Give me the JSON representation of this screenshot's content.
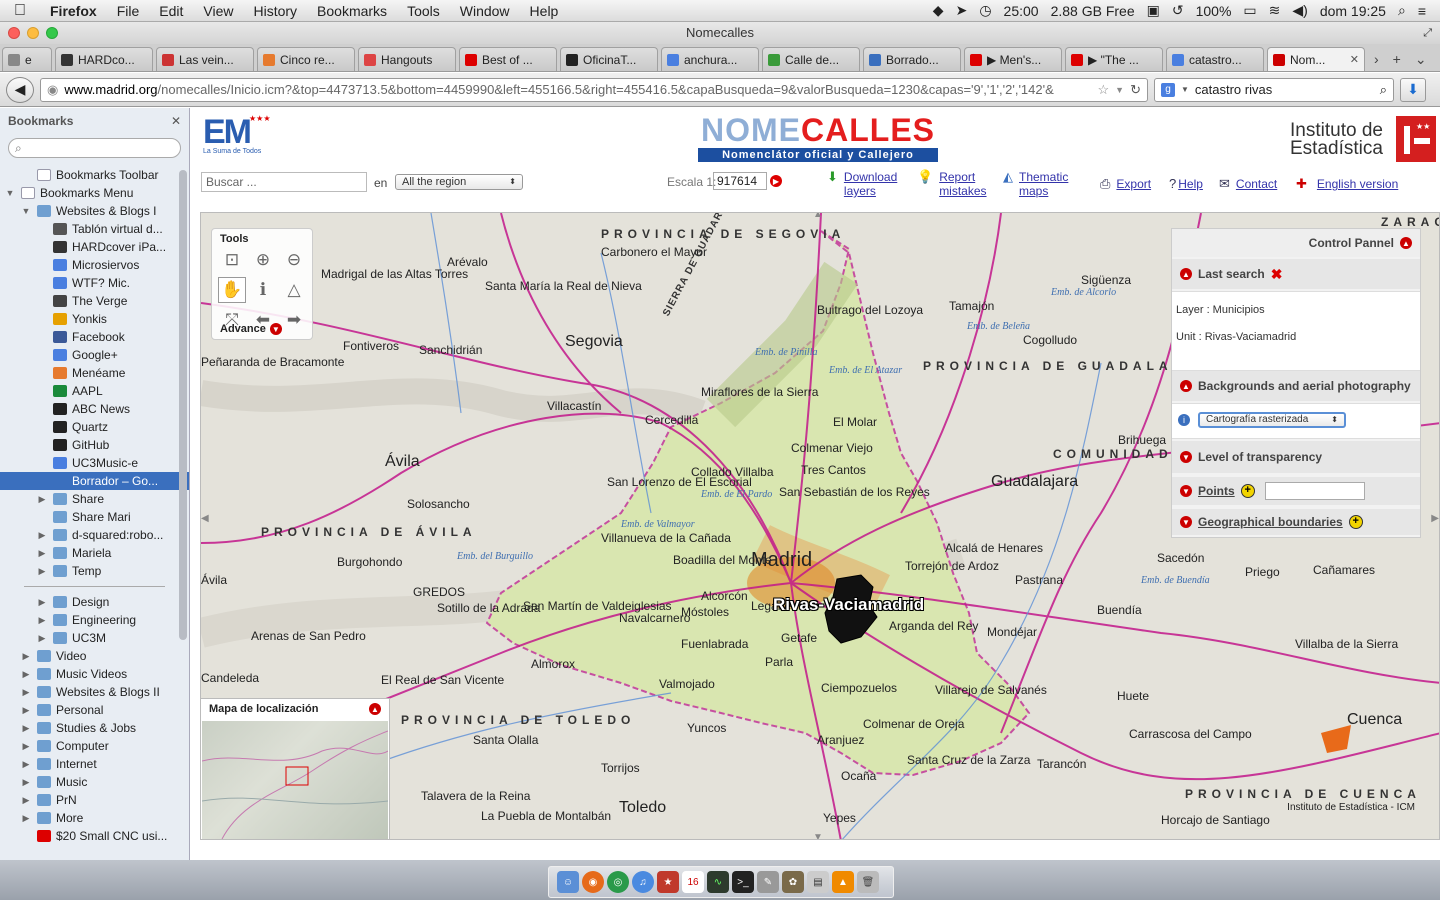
{
  "menubar": {
    "app": "Firefox",
    "items": [
      "File",
      "Edit",
      "View",
      "History",
      "Bookmarks",
      "Tools",
      "Window",
      "Help"
    ],
    "status": {
      "timer": "25:00",
      "memory": "2.88 GB Free",
      "battery": "100%",
      "clock": "dom 19:25"
    }
  },
  "window": {
    "title": "Nomecalles"
  },
  "tabs": [
    {
      "label": "e",
      "icon_color": "#888"
    },
    {
      "label": "HARDco...",
      "icon_color": "#333"
    },
    {
      "label": "Las vein...",
      "icon_color": "#c33"
    },
    {
      "label": "Cinco re...",
      "icon_color": "#e67a2e"
    },
    {
      "label": "Hangouts",
      "icon_color": "#d44"
    },
    {
      "label": "Best of ...",
      "icon_color": "#d00"
    },
    {
      "label": "OficinaT...",
      "icon_color": "#222"
    },
    {
      "label": "anchura...",
      "icon_color": "#4a7fe0"
    },
    {
      "label": "Calle de...",
      "icon_color": "#3a9b3a"
    },
    {
      "label": "Borrado...",
      "icon_color": "#3a6fbe"
    },
    {
      "label": "▶ Men's...",
      "icon_color": "#d00"
    },
    {
      "label": "▶ \"The ...",
      "icon_color": "#d00"
    },
    {
      "label": "catastro...",
      "icon_color": "#4a7fe0"
    },
    {
      "label": "Nom...",
      "icon_color": "#c00"
    }
  ],
  "navbar": {
    "url_host": "www.madrid.org",
    "url_rest": "/nomecalles/Inicio.icm?&top=4473713.5&bottom=4459990&left=455166.5&right=455416.5&capaBusqueda=9&valorBusqueda=1230&capas='9','1','2','142'&",
    "search_value": "catastro rivas"
  },
  "sidebar": {
    "title": "Bookmarks",
    "items": [
      {
        "label": "Bookmarks Toolbar",
        "depth": 1,
        "type": "special",
        "twisty": ""
      },
      {
        "label": "Bookmarks Menu",
        "depth": 0,
        "type": "special",
        "twisty": "▼"
      },
      {
        "label": "Websites & Blogs I",
        "depth": 1,
        "type": "folder",
        "twisty": "▼"
      },
      {
        "label": "Tablón virtual d...",
        "depth": 2,
        "type": "bm",
        "color": "#555"
      },
      {
        "label": "HARDcover iPa...",
        "depth": 2,
        "type": "bm",
        "color": "#333"
      },
      {
        "label": "Microsiervos",
        "depth": 2,
        "type": "bm",
        "color": "#4a7fe0"
      },
      {
        "label": "WTF? Mic.",
        "depth": 2,
        "type": "bm",
        "color": "#4a7fe0"
      },
      {
        "label": "The Verge",
        "depth": 2,
        "type": "bm",
        "color": "#444"
      },
      {
        "label": "Yonkis",
        "depth": 2,
        "type": "bm",
        "color": "#e6a000"
      },
      {
        "label": "Facebook",
        "depth": 2,
        "type": "bm",
        "color": "#3b5998"
      },
      {
        "label": "Google+",
        "depth": 2,
        "type": "bm",
        "color": "#4a7fe0"
      },
      {
        "label": "Menéame",
        "depth": 2,
        "type": "bm",
        "color": "#e67a2e"
      },
      {
        "label": "AAPL",
        "depth": 2,
        "type": "bm",
        "color": "#1a8a3a"
      },
      {
        "label": "ABC News",
        "depth": 2,
        "type": "bm",
        "color": "#222"
      },
      {
        "label": "Quartz",
        "depth": 2,
        "type": "bm",
        "color": "#222"
      },
      {
        "label": "GitHub",
        "depth": 2,
        "type": "bm",
        "color": "#222"
      },
      {
        "label": "UC3Music-e",
        "depth": 2,
        "type": "bm",
        "color": "#4a7fe0"
      },
      {
        "label": "Borrador – Go...",
        "depth": 2,
        "type": "bm",
        "color": "#3a6fbe",
        "selected": true
      },
      {
        "label": "Share",
        "depth": 2,
        "type": "folder",
        "twisty": "▶"
      },
      {
        "label": "Share Mari",
        "depth": 2,
        "type": "folder",
        "twisty": ""
      },
      {
        "label": "d-squared:robo...",
        "depth": 2,
        "type": "folder",
        "twisty": "▶"
      },
      {
        "label": "Mariela",
        "depth": 2,
        "type": "folder",
        "twisty": "▶"
      },
      {
        "label": "Temp",
        "depth": 2,
        "type": "folder",
        "twisty": "▶"
      },
      {
        "label": "—sep—",
        "depth": 0,
        "type": "sep"
      },
      {
        "label": "Design",
        "depth": 2,
        "type": "folder",
        "twisty": "▶"
      },
      {
        "label": "Engineering",
        "depth": 2,
        "type": "folder",
        "twisty": "▶"
      },
      {
        "label": "UC3M",
        "depth": 2,
        "type": "folder",
        "twisty": "▶"
      },
      {
        "label": "Video",
        "depth": 1,
        "type": "folder",
        "twisty": "▶"
      },
      {
        "label": "Music Videos",
        "depth": 1,
        "type": "folder",
        "twisty": "▶"
      },
      {
        "label": "Websites & Blogs II",
        "depth": 1,
        "type": "folder",
        "twisty": "▶"
      },
      {
        "label": "Personal",
        "depth": 1,
        "type": "folder",
        "twisty": "▶"
      },
      {
        "label": "Studies & Jobs",
        "depth": 1,
        "type": "folder",
        "twisty": "▶"
      },
      {
        "label": "Computer",
        "depth": 1,
        "type": "folder",
        "twisty": "▶"
      },
      {
        "label": "Internet",
        "depth": 1,
        "type": "folder",
        "twisty": "▶"
      },
      {
        "label": "Music",
        "depth": 1,
        "type": "folder",
        "twisty": "▶"
      },
      {
        "label": "PrN",
        "depth": 1,
        "type": "folder",
        "twisty": "▶"
      },
      {
        "label": "More",
        "depth": 1,
        "type": "folder",
        "twisty": "▶"
      },
      {
        "label": "$20 Small CNC usi...",
        "depth": 1,
        "type": "bm",
        "color": "#d00"
      }
    ]
  },
  "page": {
    "em_logo_text": "EM",
    "em_logo_sub": "La Suma de Todos",
    "nc_logo_a": "NOME",
    "nc_logo_b": "CALLES",
    "nc_subtitle": "Nomenclátor oficial y Callejero",
    "ine_line1": "Instituto de",
    "ine_line2": "Estadística",
    "search_placeholder": "Buscar ...",
    "en_label": "en",
    "region_value": "All the region",
    "scale_label": "Escala 1:",
    "scale_value": "917614",
    "links": {
      "download": "Download layers",
      "report": "Report mistakes",
      "thematic": "Thematic maps",
      "export": "Export",
      "help": "Help",
      "contact": "Contact",
      "english": "English version"
    }
  },
  "map": {
    "tools_title": "Tools",
    "advance": "Advance",
    "locmap_title": "Mapa de localización",
    "credit": "Instituto de Estadística - ICM",
    "selected_unit_label": "Rivas-Vaciamadrid",
    "labels": [
      {
        "t": "PROVINCIA DE SEGOVIA",
        "c": "prov"
      },
      {
        "t": "Carbonero el Mayor",
        "c": "town"
      },
      {
        "t": "Arévalo",
        "c": "town"
      },
      {
        "t": "Madrigal de las Altas Torres",
        "c": "town"
      },
      {
        "t": "Santa María la Real de Nieva",
        "c": "town"
      },
      {
        "t": "Segovia",
        "c": "city"
      },
      {
        "t": "Fontiveros",
        "c": "town"
      },
      {
        "t": "Sanchidrián",
        "c": "town"
      },
      {
        "t": "Peñaranda de Bracamonte",
        "c": "town"
      },
      {
        "t": "Villacastín",
        "c": "town"
      },
      {
        "t": "Ávila",
        "c": "city"
      },
      {
        "t": "Solosancho",
        "c": "town"
      },
      {
        "t": "PROVINCIA DE ÁVILA",
        "c": "prov"
      },
      {
        "t": "Burgohondo",
        "c": "town"
      },
      {
        "t": "GREDOS",
        "c": "town"
      },
      {
        "t": "Arenas de San Pedro",
        "c": "town"
      },
      {
        "t": "Candeleda",
        "c": "town"
      },
      {
        "t": "El Real de San Vicente",
        "c": "town"
      },
      {
        "t": "Sotillo de la Adrada",
        "c": "town"
      },
      {
        "t": "Madrid",
        "c": "big"
      },
      {
        "t": "Alcalá de Henares",
        "c": "town"
      },
      {
        "t": "Torrejón de Ardoz",
        "c": "town"
      },
      {
        "t": "Guadalajara",
        "c": "city"
      },
      {
        "t": "COMUNIDAD D",
        "c": "prov"
      },
      {
        "t": "PROVINCIA DE GUADALAJA",
        "c": "prov"
      },
      {
        "t": "Brihuega",
        "c": "town"
      },
      {
        "t": "Cogolludo",
        "c": "town"
      },
      {
        "t": "Sigüenza",
        "c": "town"
      },
      {
        "t": "Tamajón",
        "c": "town"
      },
      {
        "t": "Buitrago del Lozoya",
        "c": "town"
      },
      {
        "t": "Miraflores de la Sierra",
        "c": "town"
      },
      {
        "t": "El Molar",
        "c": "town"
      },
      {
        "t": "Colmenar Viejo",
        "c": "town"
      },
      {
        "t": "Tres Cantos",
        "c": "town"
      },
      {
        "t": "Collado Villalba",
        "c": "town"
      },
      {
        "t": "San Lorenzo de El Escorial",
        "c": "town"
      },
      {
        "t": "San Sebastián de los Reyes",
        "c": "town"
      },
      {
        "t": "Cercedilla",
        "c": "town"
      },
      {
        "t": "Villanueva de la Cañada",
        "c": "town"
      },
      {
        "t": "Boadilla del Monte",
        "c": "town"
      },
      {
        "t": "Alcorcón",
        "c": "town"
      },
      {
        "t": "Leganés",
        "c": "town"
      },
      {
        "t": "Móstoles",
        "c": "town"
      },
      {
        "t": "Getafe",
        "c": "town"
      },
      {
        "t": "Fuenlabrada",
        "c": "town"
      },
      {
        "t": "Navalcarnero",
        "c": "town"
      },
      {
        "t": "San Martín de Valdeiglesias",
        "c": "town"
      },
      {
        "t": "Almorox",
        "c": "town"
      },
      {
        "t": "Valmojado",
        "c": "town"
      },
      {
        "t": "Parla",
        "c": "town"
      },
      {
        "t": "Arganda del Rey",
        "c": "town"
      },
      {
        "t": "Mondéjar",
        "c": "town"
      },
      {
        "t": "Pastrana",
        "c": "town"
      },
      {
        "t": "Ciempozuelos",
        "c": "town"
      },
      {
        "t": "Villarejo de Salvanés",
        "c": "town"
      },
      {
        "t": "Colmenar de Oreja",
        "c": "town"
      },
      {
        "t": "Aranjuez",
        "c": "town"
      },
      {
        "t": "Santa Cruz de la Zarza",
        "c": "town"
      },
      {
        "t": "Ocaña",
        "c": "town"
      },
      {
        "t": "Yepes",
        "c": "town"
      },
      {
        "t": "Toledo",
        "c": "city"
      },
      {
        "t": "PROVINCIA DE TOLEDO",
        "c": "prov"
      },
      {
        "t": "Santa Olalla",
        "c": "town"
      },
      {
        "t": "Yuncos",
        "c": "town"
      },
      {
        "t": "Torrijos",
        "c": "town"
      },
      {
        "t": "Talavera de la Reina",
        "c": "town"
      },
      {
        "t": "La Puebla de Montalbán",
        "c": "town"
      },
      {
        "t": "Tarancón",
        "c": "town"
      },
      {
        "t": "Carrascosa del Campo",
        "c": "town"
      },
      {
        "t": "Huete",
        "c": "town"
      },
      {
        "t": "Cuenca",
        "c": "city"
      },
      {
        "t": "PROVINCIA DE CUENCA",
        "c": "prov"
      },
      {
        "t": "Villalba de la Sierra",
        "c": "town"
      },
      {
        "t": "Priego",
        "c": "town"
      },
      {
        "t": "Cañamares",
        "c": "town"
      },
      {
        "t": "Sacedón",
        "c": "town"
      },
      {
        "t": "Buendía",
        "c": "town"
      },
      {
        "t": "Horcajo de Santiago",
        "c": "town"
      },
      {
        "t": "Ávila",
        "c": "town"
      },
      {
        "t": "Emb. de Buendía",
        "c": "water"
      },
      {
        "t": "Emb. de Alcorlo",
        "c": "water"
      },
      {
        "t": "Emb. de Beleña",
        "c": "water"
      },
      {
        "t": "Emb. del Burguillo",
        "c": "water"
      },
      {
        "t": "Emb. de Valmayor",
        "c": "water"
      },
      {
        "t": "Emb. de El Pardo",
        "c": "water"
      },
      {
        "t": "Emb. de Pinilla",
        "c": "water"
      },
      {
        "t": "Emb. de El Atazar",
        "c": "water"
      },
      {
        "t": "SIERRA DE GUADARRAMA",
        "c": "prov"
      },
      {
        "t": "ZARAG",
        "c": "prov"
      }
    ]
  },
  "control_panel": {
    "title": "Control Pannel",
    "last_search": "Last search",
    "layer": "Layer : Municipios",
    "unit": "Unit : Rivas-Vaciamadrid",
    "backgrounds": "Backgrounds and aerial photography",
    "background_value": "Cartografía rasterizada",
    "transparency": "Level of transparency",
    "points": "Points",
    "boundaries": "Geographical boundaries"
  },
  "dock": {
    "items": [
      "finder",
      "firefox",
      "chrome",
      "itunes",
      "pdf",
      "calendar",
      "activity",
      "terminal",
      "tool",
      "gimp",
      "app",
      "vlc",
      "trash"
    ],
    "calendar_day": "16"
  }
}
